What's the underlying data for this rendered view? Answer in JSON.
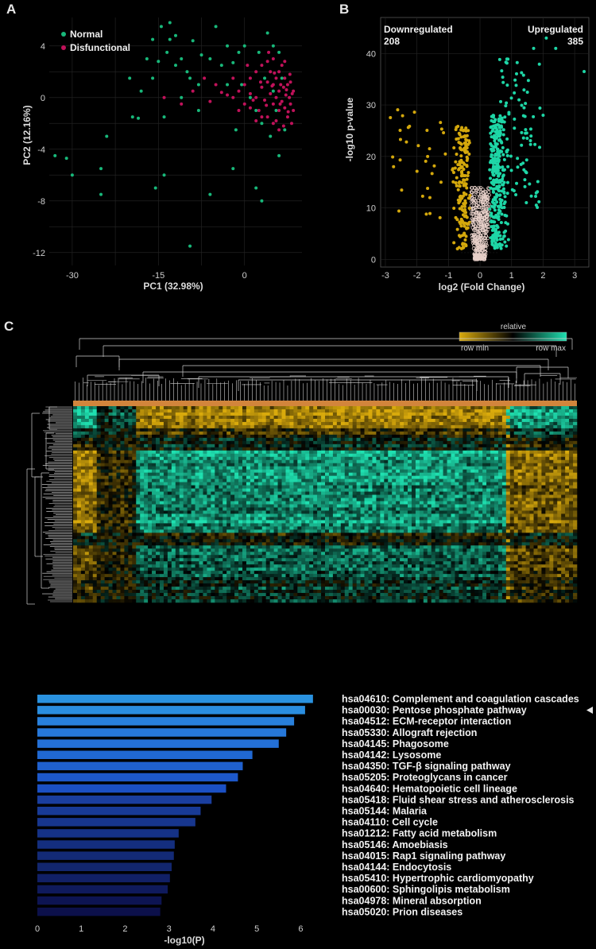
{
  "panels": {
    "a": "A",
    "b": "B",
    "c": "C"
  },
  "chart_data": [
    {
      "id": "pca",
      "type": "scatter",
      "xlabel": "PC1 (32.98%)",
      "ylabel": "PC2 (12.16%)",
      "xlim": [
        -34,
        10
      ],
      "ylim": [
        -13,
        6.2
      ],
      "xticks": [
        -30,
        -15,
        0
      ],
      "yticks": [
        4,
        0,
        -4,
        -8,
        -12
      ],
      "grid": true,
      "legend_position": "top-left",
      "series": [
        {
          "name": "Normal",
          "color": "#18b87a",
          "points": [
            [
              -33,
              -4.5
            ],
            [
              -31,
              -4.7
            ],
            [
              -30,
              -6
            ],
            [
              -25,
              -5.5
            ],
            [
              -24,
              -3
            ],
            [
              -25,
              -7.5
            ],
            [
              -19.5,
              -1.5
            ],
            [
              -18.5,
              -1.6
            ],
            [
              -15.5,
              -7
            ],
            [
              -14,
              -6
            ],
            [
              -9.5,
              -11.5
            ],
            [
              -6,
              -7.5
            ],
            [
              -2,
              -5.5
            ],
            [
              2,
              -7
            ],
            [
              3,
              -8
            ],
            [
              6,
              -4.5
            ],
            [
              -14.5,
              5.5
            ],
            [
              -13,
              5.8
            ],
            [
              -12,
              4.8
            ],
            [
              -11,
              3
            ],
            [
              -10,
              2
            ],
            [
              -9,
              4.4
            ],
            [
              -8,
              1
            ],
            [
              -7.5,
              3.3
            ],
            [
              -5,
              5.5
            ],
            [
              -3,
              4
            ],
            [
              -3,
              1
            ],
            [
              -2,
              2.7
            ],
            [
              -1,
              3.5
            ],
            [
              -0.5,
              1
            ],
            [
              1,
              0
            ],
            [
              2,
              -1
            ],
            [
              3,
              -2
            ],
            [
              4,
              5
            ],
            [
              5,
              4
            ],
            [
              6,
              3.5
            ],
            [
              3.5,
              1.5
            ],
            [
              5.5,
              -1
            ],
            [
              4.5,
              -3
            ],
            [
              7,
              -2.5
            ],
            [
              -17,
              3
            ],
            [
              -16,
              1.5
            ],
            [
              -15,
              2.8
            ],
            [
              -14,
              -1.5
            ],
            [
              -13,
              4.5
            ],
            [
              -12,
              2.5
            ],
            [
              -16,
              4.5
            ],
            [
              -13.5,
              3.5
            ],
            [
              -11,
              0
            ],
            [
              -8,
              -1
            ],
            [
              -20,
              1.5
            ],
            [
              -18,
              0.5
            ],
            [
              -6,
              3
            ],
            [
              -4,
              2.5
            ],
            [
              -1.5,
              -2.5
            ],
            [
              0,
              4
            ],
            [
              2.5,
              3.5
            ],
            [
              6.5,
              1.5
            ],
            [
              5,
              0.5
            ],
            [
              -9.5,
              1.5
            ]
          ]
        },
        {
          "name": "Disfunctional",
          "color": "#c0125a",
          "points": [
            [
              -14,
              0
            ],
            [
              -11,
              -0.5
            ],
            [
              -9,
              0.5
            ],
            [
              -7,
              1.5
            ],
            [
              -6,
              -0.3
            ],
            [
              -5,
              1
            ],
            [
              -4,
              0.4
            ],
            [
              -3,
              0.2
            ],
            [
              -2,
              1.5
            ],
            [
              -1,
              0.5
            ],
            [
              0,
              1
            ],
            [
              0,
              -0.5
            ],
            [
              1,
              0.3
            ],
            [
              1,
              1.5
            ],
            [
              2,
              0
            ],
            [
              2,
              2
            ],
            [
              2.5,
              -1
            ],
            [
              3,
              0.8
            ],
            [
              3,
              2.5
            ],
            [
              3.5,
              -0.2
            ],
            [
              4,
              1.2
            ],
            [
              4,
              -1.5
            ],
            [
              4.5,
              0.3
            ],
            [
              4.5,
              2
            ],
            [
              5,
              1
            ],
            [
              5,
              -0.5
            ],
            [
              5,
              3
            ],
            [
              5.5,
              0
            ],
            [
              5.5,
              1.5
            ],
            [
              5.5,
              -1.8
            ],
            [
              6,
              0.5
            ],
            [
              6,
              -1
            ],
            [
              6,
              2
            ],
            [
              6.3,
              1
            ],
            [
              6.5,
              -0.3
            ],
            [
              6.5,
              2.5
            ],
            [
              6.8,
              0.8
            ],
            [
              7,
              -0.8
            ],
            [
              7,
              1.5
            ],
            [
              7.2,
              0.2
            ],
            [
              7.5,
              -1.5
            ],
            [
              7.5,
              1
            ],
            [
              7.8,
              0
            ],
            [
              8,
              -0.5
            ],
            [
              8,
              1.2
            ],
            [
              8.2,
              -2
            ],
            [
              8.5,
              0.5
            ],
            [
              8.5,
              -1
            ],
            [
              6,
              -2.5
            ],
            [
              5,
              -2
            ],
            [
              3,
              -1.5
            ],
            [
              4,
              2.8
            ],
            [
              7,
              2.8
            ],
            [
              2,
              -1.8
            ],
            [
              1,
              -0.8
            ],
            [
              -1,
              -1
            ],
            [
              -2,
              0
            ],
            [
              0.5,
              2.5
            ],
            [
              6.8,
              -2.2
            ],
            [
              7.6,
              -1.1
            ],
            [
              7.9,
              1.8
            ],
            [
              3.8,
              -0.6
            ],
            [
              4.8,
              0.9
            ],
            [
              5.2,
              1.9
            ],
            [
              6.2,
              -0.5
            ],
            [
              7.3,
              0.6
            ],
            [
              8.3,
              0.3
            ],
            [
              4.2,
              3.5
            ],
            [
              2.8,
              1.2
            ],
            [
              1.5,
              -0.2
            ]
          ]
        }
      ]
    },
    {
      "id": "volcano",
      "type": "scatter",
      "xlabel": "log2 (Fold Change)",
      "ylabel": "-log10 p-value",
      "xlim": [
        -3.15,
        3.45
      ],
      "ylim": [
        -1.5,
        47
      ],
      "xticks": [
        -3,
        -2,
        -1,
        0,
        1,
        2,
        3
      ],
      "yticks": [
        0,
        10,
        20,
        30,
        40
      ],
      "grid": true,
      "threshold_x": [
        -0.3,
        0.3
      ],
      "threshold_y": 1.3,
      "annotations": {
        "down_label": "Downregulated",
        "down_count": "208",
        "up_label": "Upregulated",
        "up_count": "385"
      },
      "series": [
        {
          "name": "Down",
          "color": "#d4a80c"
        },
        {
          "name": "Up",
          "color": "#1ed6a6"
        },
        {
          "name": "NS",
          "color": "#e6cfc8"
        }
      ]
    },
    {
      "id": "heatmap",
      "type": "heatmap",
      "legend_title": "relative",
      "legend_min": "row min",
      "legend_max": "row max",
      "colors": {
        "min": "#d9aa0c",
        "mid": "#000000",
        "max": "#1fe0b0",
        "group_bar": "#d2853c"
      }
    },
    {
      "id": "enrichment",
      "type": "bar",
      "orientation": "horizontal",
      "xlabel": "-log10(P)",
      "xlim": [
        0,
        6.5
      ],
      "xticks": [
        0,
        1,
        2,
        3,
        4,
        5,
        6
      ],
      "categories": [
        "hsa04610: Complement and coagulation cascades",
        "hsa00030: Pentose phosphate pathway",
        "hsa04512: ECM-receptor interaction",
        "hsa05330: Allograft rejection",
        "hsa04145: Phagosome",
        "hsa04142: Lysosome",
        "hsa04350: TGF-β signaling pathway",
        "hsa05205: Proteoglycans in cancer",
        "hsa04640: Hematopoietic cell lineage",
        "hsa05418: Fluid shear stress and atherosclerosis",
        "hsa05144: Malaria",
        "hsa04110: Cell cycle",
        "hsa01212: Fatty acid metabolism",
        "hsa05146: Amoebiasis",
        "hsa04015: Rap1 signaling pathway",
        "hsa04144: Endocytosis",
        "hsa05410: Hypertrophic cardiomyopathy",
        "hsa00600: Sphingolipis metabolism",
        "hsa04978: Mineral absorption",
        "hsa05020: Prion diseases"
      ],
      "values": [
        6.28,
        6.1,
        5.85,
        5.67,
        5.5,
        4.9,
        4.68,
        4.57,
        4.3,
        3.97,
        3.72,
        3.6,
        3.22,
        3.13,
        3.11,
        3.06,
        3.02,
        2.97,
        2.83,
        2.8
      ],
      "colors": [
        "#2a92e0",
        "#2a8ee0",
        "#2880dc",
        "#2678da",
        "#2470d6",
        "#2068d2",
        "#1f60ce",
        "#1d58ca",
        "#1b50c4",
        "#1a3e9e",
        "#183a96",
        "#17368e",
        "#153286",
        "#142e7e",
        "#132a76",
        "#12266e",
        "#112066",
        "#0f1a5c",
        "#0d1452",
        "#0c104a"
      ]
    }
  ]
}
